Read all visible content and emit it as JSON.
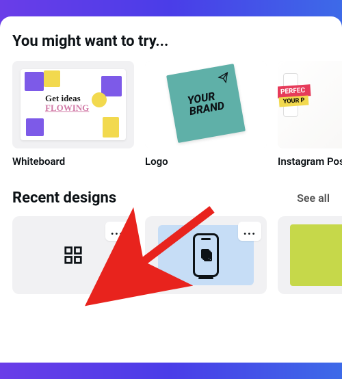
{
  "sections": {
    "try_title": "You might want to try...",
    "recent_title": "Recent designs",
    "see_all": "See all"
  },
  "templates": [
    {
      "label": "Whiteboard",
      "text1": "Get ideas",
      "text2": "FLOWING"
    },
    {
      "label": "Logo",
      "card_text": "YOUR\nBRAND"
    },
    {
      "label": "Instagram Post (Square)",
      "ribbon1": "PERFEC",
      "ribbon2": "YOUR P"
    }
  ],
  "recent": [
    {
      "icon": "grid-icon",
      "more": "..."
    },
    {
      "icon": "phone-stack-icon",
      "more": "..."
    },
    {
      "icon": "green-canvas",
      "more": ""
    }
  ],
  "colors": {
    "purple": "#7d5ae8",
    "yellow": "#f2d94e",
    "teal": "#5fb0a8",
    "blue_light": "#c6ddf6",
    "lime": "#c6d84a",
    "red": "#e63b5a"
  }
}
